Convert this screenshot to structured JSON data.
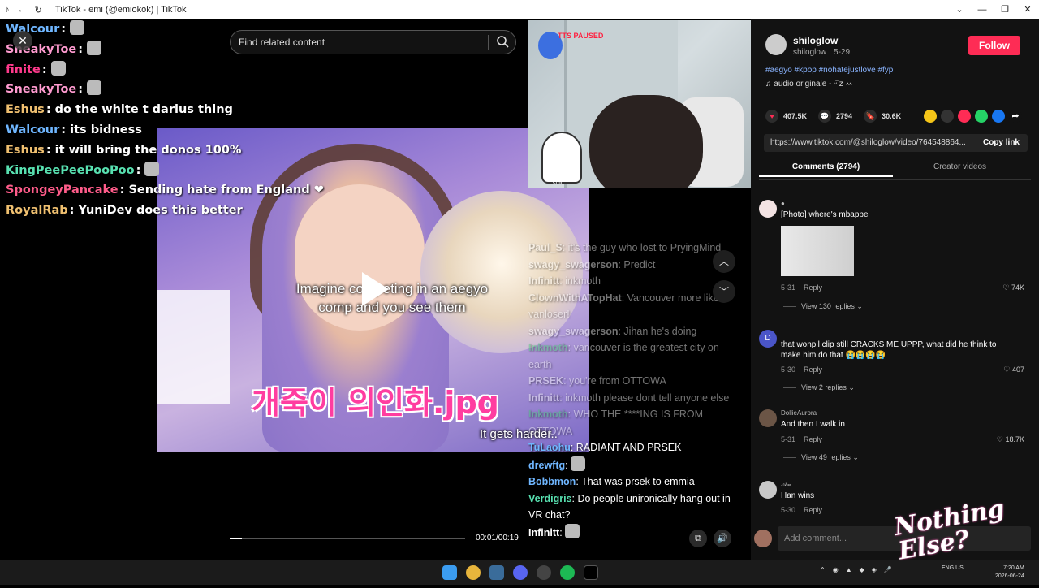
{
  "window": {
    "title": "TikTok - emi (@emiokok) | TikTok",
    "controls": [
      "⌄",
      "—",
      "❐",
      "✕"
    ]
  },
  "search": {
    "placeholder": "Find related content"
  },
  "chat_left": [
    {
      "user": "Walcour",
      "color": "#6fb6ff",
      "text": ""
    },
    {
      "user": "SneakyToe",
      "color": "#ff9bd0",
      "text": ""
    },
    {
      "user": "finite",
      "color": "#ff3a8c",
      "text": ""
    },
    {
      "user": "SneakyToe",
      "color": "#ff9bd0",
      "text": ""
    },
    {
      "user": "Eshus",
      "color": "#f0c070",
      "text": "do the white t darius thing"
    },
    {
      "user": "Walcour",
      "color": "#6fb6ff",
      "text": "its bidness"
    },
    {
      "user": "Eshus",
      "color": "#f0c070",
      "text": "it will bring the donos 100%"
    },
    {
      "user": "KingPeePeePooPoo",
      "color": "#58e0b0",
      "text": ""
    },
    {
      "user": "SpongeyPancake",
      "color": "#ff5c8a",
      "text": "Sending hate from England ❤"
    },
    {
      "user": "RoyalRab",
      "color": "#f0c070",
      "text": "YuniDev does this better"
    }
  ],
  "video": {
    "caption": "Imagine competing in an aegyo comp and you see them",
    "korean_text": "개죽이 의인화.jpg",
    "subtitle": "It gets harder..",
    "progress": 0.05,
    "time": "00:01/00:19"
  },
  "cam": {
    "overlay_text": "TTS PAUSED",
    "name_tag": "emi"
  },
  "chat_right": [
    {
      "user": "Paul_S",
      "text": "it's the guy who lost to PryingMind",
      "dim": true,
      "color": "#ffffff"
    },
    {
      "user": "swagy_swagerson",
      "text": "Predict",
      "dim": true,
      "color": "#ffffff"
    },
    {
      "user": "Infinitt",
      "text": "inkmoth",
      "dim": true,
      "color": "#ffffff"
    },
    {
      "user": "ClownWithATopHat",
      "text": "Vancouver more like vanloser!",
      "dim": true,
      "color": "#ffffff"
    },
    {
      "user": "swagy_swagerson",
      "text": "Jihan he's doing",
      "dim": true,
      "color": "#ffffff"
    },
    {
      "user": "Inkmoth",
      "text": "vancouver is the greatest city on earth",
      "dim": true,
      "color": "#40d070"
    },
    {
      "user": "PRSEK",
      "text": "you're from OTTOWA",
      "dim": true,
      "color": "#ffffff"
    },
    {
      "user": "Infinitt",
      "text": "inkmoth please dont tell anyone else",
      "dim": true,
      "color": "#ffffff"
    },
    {
      "user": "Inkmoth",
      "text": "WHO THE ****ING IS FROM OTTOWA",
      "dim": true,
      "color": "#40d070"
    },
    {
      "user": "TuLaohu",
      "text": "RADIANT AND PRSEK",
      "dim": false,
      "color": "#6fb6ff"
    },
    {
      "user": "drewftg",
      "text": "",
      "dim": false,
      "color": "#6fb6ff"
    },
    {
      "user": "Bobbmon",
      "text": "That was prsek to emmia",
      "dim": false,
      "color": "#6fb6ff"
    },
    {
      "user": "Verdigris",
      "text": "Do people unironically hang out in VR chat?",
      "dim": false,
      "color": "#58e0b0"
    },
    {
      "user": "Infinitt",
      "text": "",
      "dim": false,
      "color": "#ffffff"
    }
  ],
  "panel": {
    "user": "shiloglow",
    "sub": "shiloglow · 5-29",
    "follow": "Follow",
    "tags": "#aegyo #kpop #nohatejustlove #fyp",
    "music": "♫  audio originale - ᵕ̈ z ꕀ",
    "likes": "407.5K",
    "comments_count": "2794",
    "saves": "30.6K",
    "link": "https://www.tiktok.com/@shiloglow/video/764548864...",
    "copy_link": "Copy link",
    "tab_comments": "Comments (2794)",
    "tab_creator": "Creator videos",
    "add_comment": "Add comment..."
  },
  "comments": [
    {
      "user": "●",
      "text": "[Photo] where's mbappe",
      "date": "5-31",
      "reply": "Reply",
      "likes": "74K",
      "view": "View 130 replies"
    },
    {
      "user": "",
      "text": "that wonpil clip still CRACKS ME UPPP, what did he think to make him do that 😭😭😭😭",
      "date": "5-30",
      "reply": "Reply",
      "likes": "407",
      "view": "View 2 replies"
    },
    {
      "user": "DollieAurora",
      "text": "And then I walk in",
      "date": "5-31",
      "reply": "Reply",
      "likes": "18.7K",
      "view": "View 49 replies"
    },
    {
      "user": "𝒜𝓃",
      "text": "Han wins",
      "date": "5-30",
      "reply": "Reply",
      "likes": "",
      "view": ""
    }
  ],
  "overlay_logo": "Nothing Else?",
  "taskbar": {
    "lang": "ENG US",
    "time": "7:20 AM",
    "date": "2026-06-24"
  }
}
